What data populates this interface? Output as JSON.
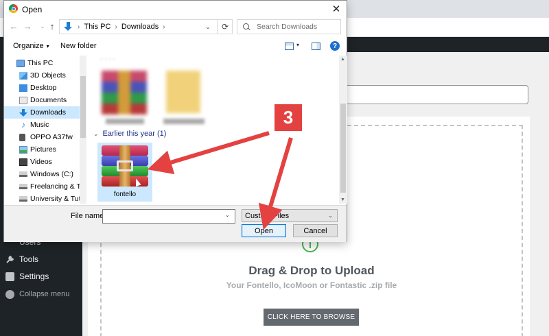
{
  "dialog": {
    "title": "Open",
    "close_glyph": "✕",
    "nav": {
      "back": "←",
      "forward": "→",
      "recent": "⌄",
      "up": "↑"
    },
    "breadcrumb": [
      "This PC",
      "Downloads"
    ],
    "breadcrumb_sep": "›",
    "address_dropdown": "⌄",
    "refresh_glyph": "⟳",
    "search_placeholder": "Search Downloads",
    "toolbar": {
      "organize": "Organize",
      "organize_caret": "▾",
      "new_folder": "New folder",
      "view_caret": "▾",
      "help": "?"
    },
    "sidebar": [
      {
        "label": "This PC",
        "icon": "computer-icon"
      },
      {
        "label": "3D Objects",
        "icon": "3d-objects-icon"
      },
      {
        "label": "Desktop",
        "icon": "desktop-icon"
      },
      {
        "label": "Documents",
        "icon": "documents-icon"
      },
      {
        "label": "Downloads",
        "icon": "downloads-icon",
        "selected": true
      },
      {
        "label": "Music",
        "icon": "music-icon"
      },
      {
        "label": "OPPO A37fw",
        "icon": "phone-icon"
      },
      {
        "label": "Pictures",
        "icon": "pictures-icon"
      },
      {
        "label": "Videos",
        "icon": "videos-icon"
      },
      {
        "label": "Windows (C:)",
        "icon": "drive-icon"
      },
      {
        "label": "Freelancing & Te",
        "icon": "drive-icon"
      },
      {
        "label": "University & Tut",
        "icon": "drive-icon"
      }
    ],
    "group_chevron": "⌄",
    "group_header": "Earlier this year (1)",
    "file": {
      "name": "fontello",
      "icon": "winrar-archive-icon",
      "selected": true
    },
    "file_name_label": "File name:",
    "file_name_value": "",
    "file_name_caret": "⌄",
    "file_type": "Custom Files",
    "file_type_caret": "⌄",
    "open_label": "Open",
    "cancel_label": "Cancel",
    "scroll_up": "▲",
    "scroll_down": "▼"
  },
  "annotation": {
    "step": "3",
    "color": "#e34241"
  },
  "wp_menu": [
    {
      "label": "Users",
      "icon": "users-icon"
    },
    {
      "label": "Tools",
      "icon": "tools-icon"
    },
    {
      "label": "Settings",
      "icon": "settings-icon"
    },
    {
      "label": "Collapse menu",
      "icon": "collapse-icon"
    }
  ],
  "upload": {
    "title": "Drag & Drop to Upload",
    "subtitle": "Your Fontello, IcoMoon or Fontastic .zip file",
    "button": "CLICK HERE TO BROWSE"
  },
  "colors": {
    "selection": "#cce8ff",
    "accent": "#0078d7",
    "sidebar_bg": "#1d2327",
    "upload_icon": "#46b450"
  }
}
